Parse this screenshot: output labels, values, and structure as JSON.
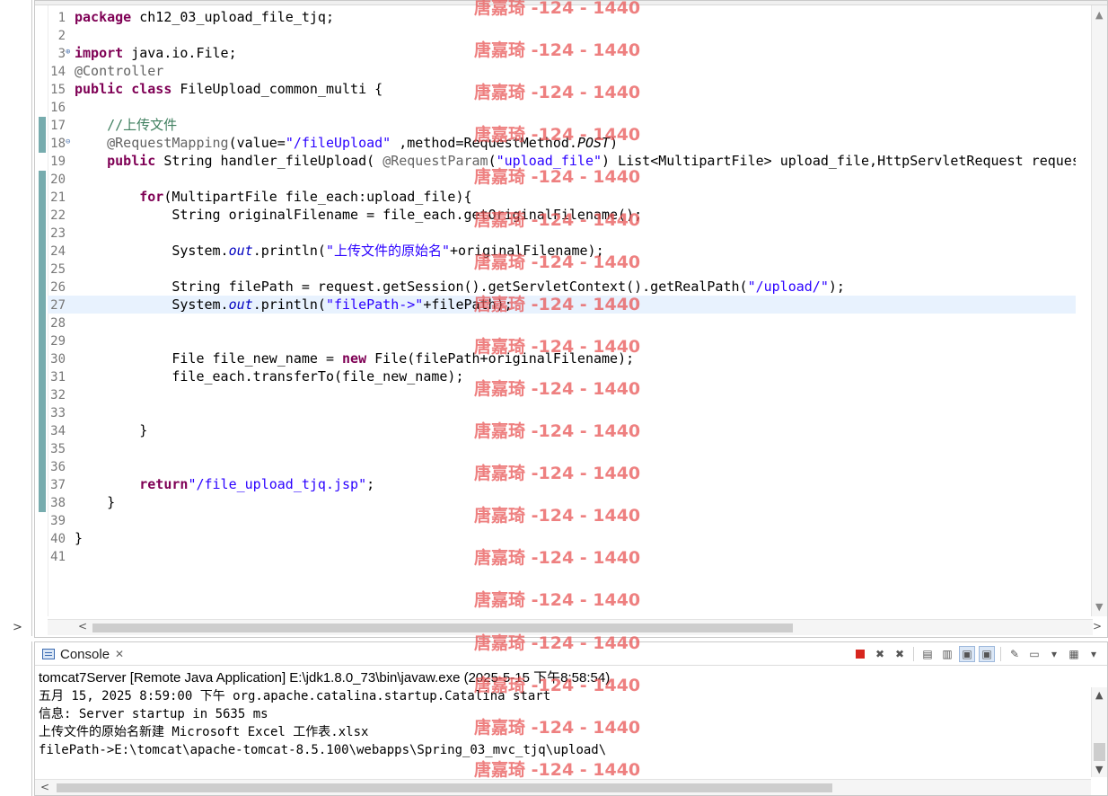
{
  "editor": {
    "lines": [
      {
        "n": "1",
        "parts": [
          [
            "kw",
            "package"
          ],
          [
            "src",
            " ch12_03_upload_file_tjq;"
          ]
        ]
      },
      {
        "n": "2",
        "parts": []
      },
      {
        "n": "3",
        "fold": "+",
        "parts": [
          [
            "kw",
            "import"
          ],
          [
            "src",
            " java.io.File;"
          ]
        ]
      },
      {
        "n": "14",
        "parts": [
          [
            "ann",
            "@Controller"
          ]
        ]
      },
      {
        "n": "15",
        "parts": [
          [
            "kw",
            "public"
          ],
          [
            "src",
            " "
          ],
          [
            "kw",
            "class"
          ],
          [
            "src",
            " FileUpload_common_multi {"
          ]
        ]
      },
      {
        "n": "16",
        "parts": []
      },
      {
        "n": "17",
        "parts": [
          [
            "src",
            "    "
          ],
          [
            "cmt",
            "//上传文件"
          ]
        ]
      },
      {
        "n": "18",
        "fold": "-",
        "parts": [
          [
            "src",
            "    "
          ],
          [
            "ann",
            "@RequestMapping"
          ],
          [
            "src",
            "(value="
          ],
          [
            "str",
            "\"/fileUpload\""
          ],
          [
            "src",
            " ,method=RequestMethod."
          ],
          [
            "itc",
            "POST"
          ],
          [
            "src",
            ")"
          ]
        ]
      },
      {
        "n": "19",
        "parts": [
          [
            "src",
            "    "
          ],
          [
            "kw",
            "public"
          ],
          [
            "src",
            " String handler_fileUpload( "
          ],
          [
            "ann",
            "@RequestParam"
          ],
          [
            "src",
            "("
          ],
          [
            "str",
            "\"upload_file\""
          ],
          [
            "src",
            ") List<MultipartFile> upload_file,HttpServletRequest reques"
          ]
        ]
      },
      {
        "n": "20",
        "parts": []
      },
      {
        "n": "21",
        "parts": [
          [
            "src",
            "        "
          ],
          [
            "kw",
            "for"
          ],
          [
            "src",
            "(MultipartFile file_each:upload_file){"
          ]
        ]
      },
      {
        "n": "22",
        "parts": [
          [
            "src",
            "            String originalFilename = file_each.getOriginalFilename();"
          ]
        ]
      },
      {
        "n": "23",
        "parts": []
      },
      {
        "n": "24",
        "parts": [
          [
            "src",
            "            System."
          ],
          [
            "it",
            "out"
          ],
          [
            "src",
            ".println("
          ],
          [
            "str",
            "\"上传文件的原始名\""
          ],
          [
            "src",
            "+originalFilename);"
          ]
        ]
      },
      {
        "n": "25",
        "parts": []
      },
      {
        "n": "26",
        "parts": [
          [
            "src",
            "            String filePath = request.getSession().getServletContext().getRealPath("
          ],
          [
            "str",
            "\"/upload/\""
          ],
          [
            "src",
            ");"
          ]
        ]
      },
      {
        "n": "27",
        "current": true,
        "parts": [
          [
            "src",
            "            System."
          ],
          [
            "it",
            "out"
          ],
          [
            "src",
            ".println("
          ],
          [
            "str",
            "\"filePath->\""
          ],
          [
            "src",
            "+filePath);"
          ]
        ]
      },
      {
        "n": "28",
        "parts": []
      },
      {
        "n": "29",
        "parts": []
      },
      {
        "n": "30",
        "parts": [
          [
            "src",
            "            File file_new_name = "
          ],
          [
            "kw",
            "new"
          ],
          [
            "src",
            " File(filePath+originalFilename);"
          ]
        ]
      },
      {
        "n": "31",
        "parts": [
          [
            "src",
            "            file_each.transferTo(file_new_name);"
          ]
        ]
      },
      {
        "n": "32",
        "parts": []
      },
      {
        "n": "33",
        "parts": []
      },
      {
        "n": "34",
        "parts": [
          [
            "src",
            "        }"
          ]
        ]
      },
      {
        "n": "35",
        "parts": []
      },
      {
        "n": "36",
        "parts": []
      },
      {
        "n": "37",
        "parts": [
          [
            "src",
            "        "
          ],
          [
            "kw",
            "return"
          ],
          [
            "str",
            "\"/file_upload_tjq.jsp\""
          ],
          [
            "src",
            ";"
          ]
        ]
      },
      {
        "n": "38",
        "parts": [
          [
            "src",
            "    }"
          ]
        ]
      },
      {
        "n": "39",
        "parts": []
      },
      {
        "n": "40",
        "parts": [
          [
            "src",
            "}"
          ]
        ]
      },
      {
        "n": "41",
        "parts": []
      }
    ]
  },
  "console": {
    "tab_label": "Console",
    "close_glyph": "✕",
    "title": "tomcat7Server [Remote Java Application] E:\\jdk1.8.0_73\\bin\\javaw.exe (2025-5-15 下午8:58:54)",
    "lines": [
      "五月 15, 2025 8:59:00 下午 org.apache.catalina.startup.Catalina start",
      "信息: Server startup in 5635 ms",
      "上传文件的原始名新建 Microsoft Excel 工作表.xlsx",
      "filePath->E:\\tomcat\\apache-tomcat-8.5.100\\webapps\\Spring_03_mvc_tjq\\upload\\"
    ],
    "toolbar_icons": [
      "terminate-icon",
      "remove-launch-icon",
      "remove-all-icon",
      "clear-console-icon",
      "scroll-lock-icon",
      "show-stdout-icon",
      "show-stderr-icon",
      "pin-console-icon",
      "display-console-icon",
      "dropdown-icon",
      "open-console-icon",
      "dropdown-icon"
    ]
  },
  "watermark": {
    "text": "唐嘉琦 -124 - 1440"
  },
  "colors": {
    "keyword": "#7f0055",
    "string": "#2a00ff",
    "comment": "#3f7f5f",
    "annotation": "#646464",
    "current_line": "#e8f2fe",
    "watermark": "#e85656"
  }
}
